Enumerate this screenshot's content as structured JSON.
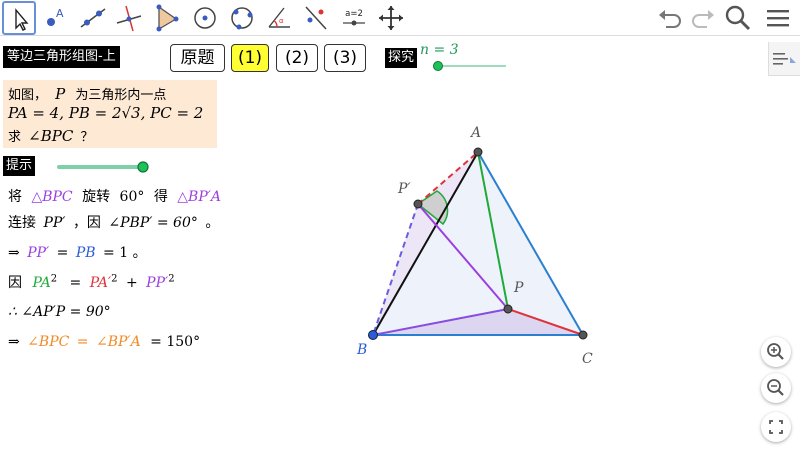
{
  "toolbar": {
    "tools": [
      "move-tool",
      "point-tool",
      "line-tool",
      "perpendicular-line-tool",
      "polygon-tool",
      "circle-center-tool",
      "circle-three-points-tool",
      "angle-tool",
      "reflect-tool",
      "slider-tool",
      "move-graphics-view-tool"
    ],
    "slider_tool_label": "a=2",
    "right": [
      "undo-icon",
      "redo-icon",
      "search-icon",
      "menu-icon"
    ]
  },
  "title": "等边三角形组图-上",
  "tabs": [
    "原题",
    "(1)",
    "(2)",
    "(3)"
  ],
  "selected_tab": 1,
  "explore_label": "探究",
  "n_label": "n = 3",
  "n_slider_value": 0,
  "problem": {
    "line1a": "如图，",
    "line1p": "P",
    "line1b": "为三角形内一点",
    "line2": "PA = 4, PB = 2√3, PC = 2",
    "line3a": "求",
    "line3b": "∠BPC",
    "line3c": "？"
  },
  "hint_label": "提示",
  "hint_slider_value": 1,
  "steps": {
    "s1": [
      "将",
      "△BPC",
      "旋转",
      "60°",
      "得",
      "△BP′A"
    ],
    "s2": [
      "连接",
      "PP′",
      "，因",
      "∠PBP′ = 60°",
      "。"
    ],
    "s3": [
      "⇒",
      "PP′",
      "=",
      "PB",
      "= 1",
      "。"
    ],
    "s4": [
      "因",
      "PA",
      "2",
      "=",
      "PA′",
      "2",
      "+",
      "PP′",
      "2"
    ],
    "s5": [
      "∴ ∠AP′P = 90°"
    ],
    "s6": [
      "⇒",
      "∠BPC",
      "=",
      "∠BP′A",
      "= 150°"
    ]
  },
  "points": {
    "A": "A",
    "B": "B",
    "C": "C",
    "P": "P",
    "Pp": "P′"
  },
  "colors": {
    "accent": "#6a8fd9",
    "purple": "#9c3fe0",
    "blue": "#2b5bd8",
    "green": "#1faa3a",
    "red": "#e0323a",
    "orange": "#f08a24",
    "problem_bg": "#fde9d4",
    "selected_tab": "#ffff33"
  }
}
